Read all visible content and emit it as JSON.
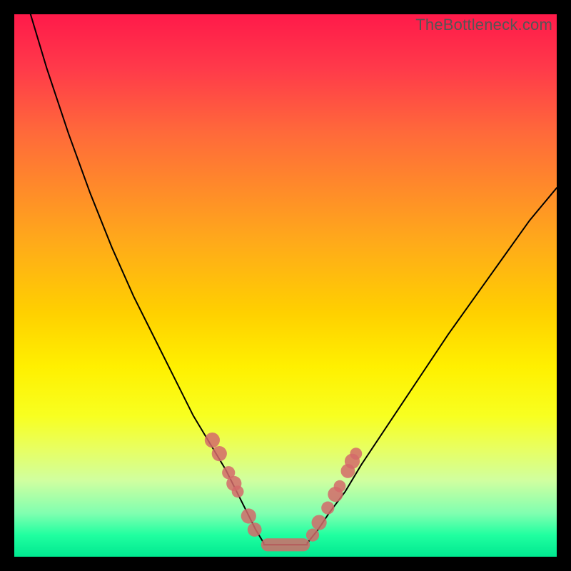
{
  "watermark": "TheBottleneck.com",
  "chart_data": {
    "type": "line",
    "title": "",
    "xlabel": "",
    "ylabel": "",
    "xlim": [
      0,
      100
    ],
    "ylim": [
      0,
      100
    ],
    "grid": false,
    "legend": false,
    "note": "V-shaped bottleneck curve on rainbow background; axis tick values not labeled in source image — x/y are normalized 0–100 estimates read from pixel position.",
    "series": [
      {
        "name": "curve-left",
        "x": [
          3,
          6,
          10,
          14,
          18,
          22,
          26,
          30,
          33,
          36,
          39,
          41,
          43,
          44.5,
          46
        ],
        "y": [
          100,
          90,
          78,
          67,
          57,
          48,
          40,
          32,
          26,
          21,
          16,
          12,
          8,
          5,
          2.5
        ]
      },
      {
        "name": "curve-right",
        "x": [
          54,
          56,
          58,
          61,
          64,
          68,
          72,
          76,
          80,
          85,
          90,
          95,
          100
        ],
        "y": [
          2.5,
          5,
          8,
          12,
          17,
          23,
          29,
          35,
          41,
          48,
          55,
          62,
          68
        ]
      },
      {
        "name": "flat-bottom",
        "x": [
          46,
          54
        ],
        "y": [
          2.2,
          2.2
        ]
      }
    ],
    "markers_left": [
      {
        "x": 36.5,
        "y": 21.5,
        "r": 1.4
      },
      {
        "x": 37.8,
        "y": 19.0,
        "r": 1.4
      },
      {
        "x": 39.5,
        "y": 15.5,
        "r": 1.2
      },
      {
        "x": 40.5,
        "y": 13.5,
        "r": 1.4
      },
      {
        "x": 41.2,
        "y": 12.0,
        "r": 1.1
      },
      {
        "x": 43.2,
        "y": 7.5,
        "r": 1.4
      },
      {
        "x": 44.3,
        "y": 5.0,
        "r": 1.3
      }
    ],
    "markers_right": [
      {
        "x": 55.0,
        "y": 4.0,
        "r": 1.2
      },
      {
        "x": 56.2,
        "y": 6.3,
        "r": 1.4
      },
      {
        "x": 57.8,
        "y": 9.0,
        "r": 1.2
      },
      {
        "x": 59.2,
        "y": 11.5,
        "r": 1.4
      },
      {
        "x": 60.0,
        "y": 13.0,
        "r": 1.1
      },
      {
        "x": 61.5,
        "y": 15.8,
        "r": 1.3
      },
      {
        "x": 62.3,
        "y": 17.6,
        "r": 1.4
      },
      {
        "x": 63.0,
        "y": 19.0,
        "r": 1.1
      }
    ],
    "bottom_pill": {
      "x0": 45.5,
      "x1": 54.5,
      "y": 2.2,
      "thickness": 2.4
    }
  }
}
